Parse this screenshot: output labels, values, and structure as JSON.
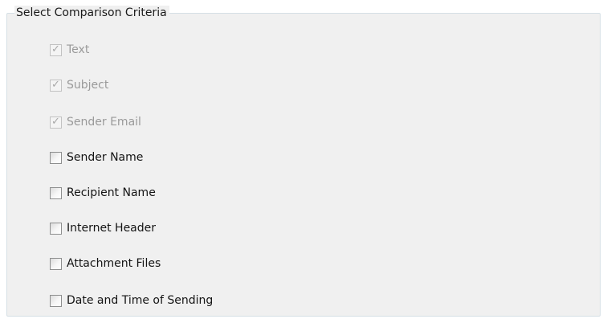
{
  "group": {
    "title": "Select Comparison Criteria"
  },
  "options": [
    {
      "label": "Text",
      "checked": true,
      "enabled": false
    },
    {
      "label": "Subject",
      "checked": true,
      "enabled": false
    },
    {
      "label": "Sender Email",
      "checked": true,
      "enabled": false
    },
    {
      "label": "Sender Name",
      "checked": false,
      "enabled": true
    },
    {
      "label": "Recipient Name",
      "checked": false,
      "enabled": true
    },
    {
      "label": "Internet Header",
      "checked": false,
      "enabled": true
    },
    {
      "label": "Attachment Files",
      "checked": false,
      "enabled": true
    },
    {
      "label": "Date and Time of Sending",
      "checked": false,
      "enabled": true
    }
  ],
  "icons": {
    "check": "checkmark-icon"
  }
}
